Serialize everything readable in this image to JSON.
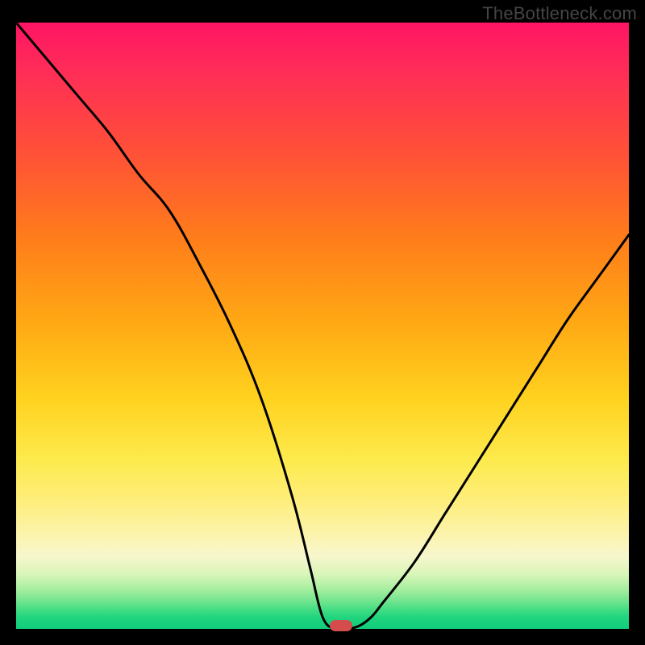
{
  "watermark": "TheBottleneck.com",
  "chart_data": {
    "type": "line",
    "title": "",
    "xlabel": "",
    "ylabel": "",
    "xlim": [
      0,
      100
    ],
    "ylim": [
      0,
      100
    ],
    "x": [
      0,
      5,
      10,
      15,
      20,
      25,
      30,
      35,
      40,
      45,
      48,
      50,
      52,
      54,
      56,
      58,
      60,
      65,
      70,
      75,
      80,
      85,
      90,
      95,
      100
    ],
    "values": [
      100,
      94,
      88,
      82,
      75,
      69,
      60,
      50,
      38,
      22,
      10,
      2,
      0,
      0,
      0.5,
      2,
      4.5,
      11,
      19,
      27,
      35,
      43,
      51,
      58,
      65
    ],
    "marker": {
      "x": 53,
      "y": 0.5
    },
    "background_gradient": {
      "top": "#ff1464",
      "middle": "#ffd21f",
      "bottom": "#10ce7b"
    },
    "curve_color": "#000000",
    "marker_color": "#d54c4c"
  }
}
